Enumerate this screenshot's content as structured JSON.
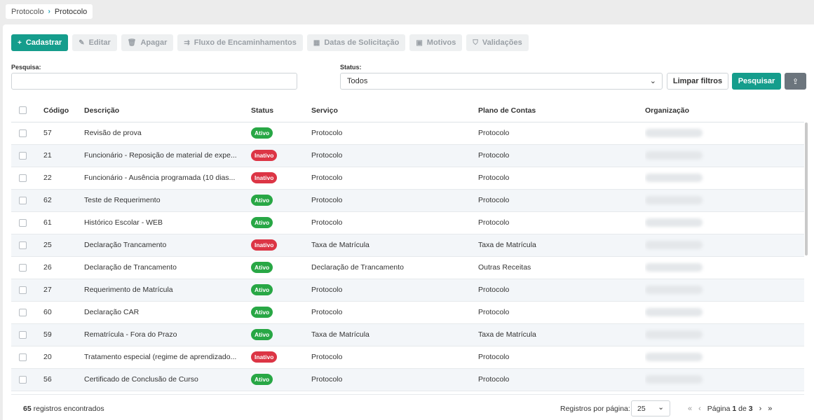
{
  "breadcrumb": {
    "root": "Protocolo",
    "current": "Protocolo"
  },
  "toolbar": {
    "add": "Cadastrar",
    "edit": "Editar",
    "delete": "Apagar",
    "flow": "Fluxo de Encaminhamentos",
    "dates": "Datas de Solicitação",
    "reasons": "Motivos",
    "validations": "Validações"
  },
  "filters": {
    "search_label": "Pesquisa:",
    "search_value": "",
    "status_label": "Status:",
    "status_value": "Todos",
    "clear": "Limpar filtros",
    "search_button": "Pesquisar"
  },
  "table": {
    "headers": [
      "Código",
      "Descrição",
      "Status",
      "Serviço",
      "Plano de Contas",
      "Organização"
    ],
    "rows": [
      {
        "code": "57",
        "desc": "Revisão de prova",
        "status": "Ativo",
        "service": "Protocolo",
        "plan": "Protocolo"
      },
      {
        "code": "21",
        "desc": "Funcionário - Reposição de material de expe...",
        "status": "Inativo",
        "service": "Protocolo",
        "plan": "Protocolo"
      },
      {
        "code": "22",
        "desc": "Funcionário - Ausência programada (10 dias...",
        "status": "Inativo",
        "service": "Protocolo",
        "plan": "Protocolo"
      },
      {
        "code": "62",
        "desc": "Teste de Requerimento",
        "status": "Ativo",
        "service": "Protocolo",
        "plan": "Protocolo"
      },
      {
        "code": "61",
        "desc": "Histórico Escolar - WEB",
        "status": "Ativo",
        "service": "Protocolo",
        "plan": "Protocolo"
      },
      {
        "code": "25",
        "desc": "Declaração Trancamento",
        "status": "Inativo",
        "service": "Taxa de Matrícula",
        "plan": "Taxa de Matrícula"
      },
      {
        "code": "26",
        "desc": "Declaração de Trancamento",
        "status": "Ativo",
        "service": "Declaração de Trancamento",
        "plan": "Outras Receitas"
      },
      {
        "code": "27",
        "desc": "Requerimento de Matrícula",
        "status": "Ativo",
        "service": "Protocolo",
        "plan": "Protocolo"
      },
      {
        "code": "60",
        "desc": "Declaração CAR",
        "status": "Ativo",
        "service": "Protocolo",
        "plan": "Protocolo"
      },
      {
        "code": "59",
        "desc": "Rematrícula - Fora do Prazo",
        "status": "Ativo",
        "service": "Taxa de Matrícula",
        "plan": "Taxa de Matrícula"
      },
      {
        "code": "20",
        "desc": "Tratamento especial (regime de aprendizado...",
        "status": "Inativo",
        "service": "Protocolo",
        "plan": "Protocolo"
      },
      {
        "code": "56",
        "desc": "Certificado de Conclusão de Curso",
        "status": "Ativo",
        "service": "Protocolo",
        "plan": "Protocolo"
      }
    ]
  },
  "footer": {
    "count": "65",
    "count_suffix": " registros encontrados",
    "per_page_label": "Registros por página:",
    "per_page": "25",
    "page_prefix": "Página ",
    "page": "1",
    "page_of": " de ",
    "total_pages": "3"
  },
  "colors": {
    "primary": "#159d8c",
    "active": "#28a745",
    "inactive": "#dc3545"
  }
}
